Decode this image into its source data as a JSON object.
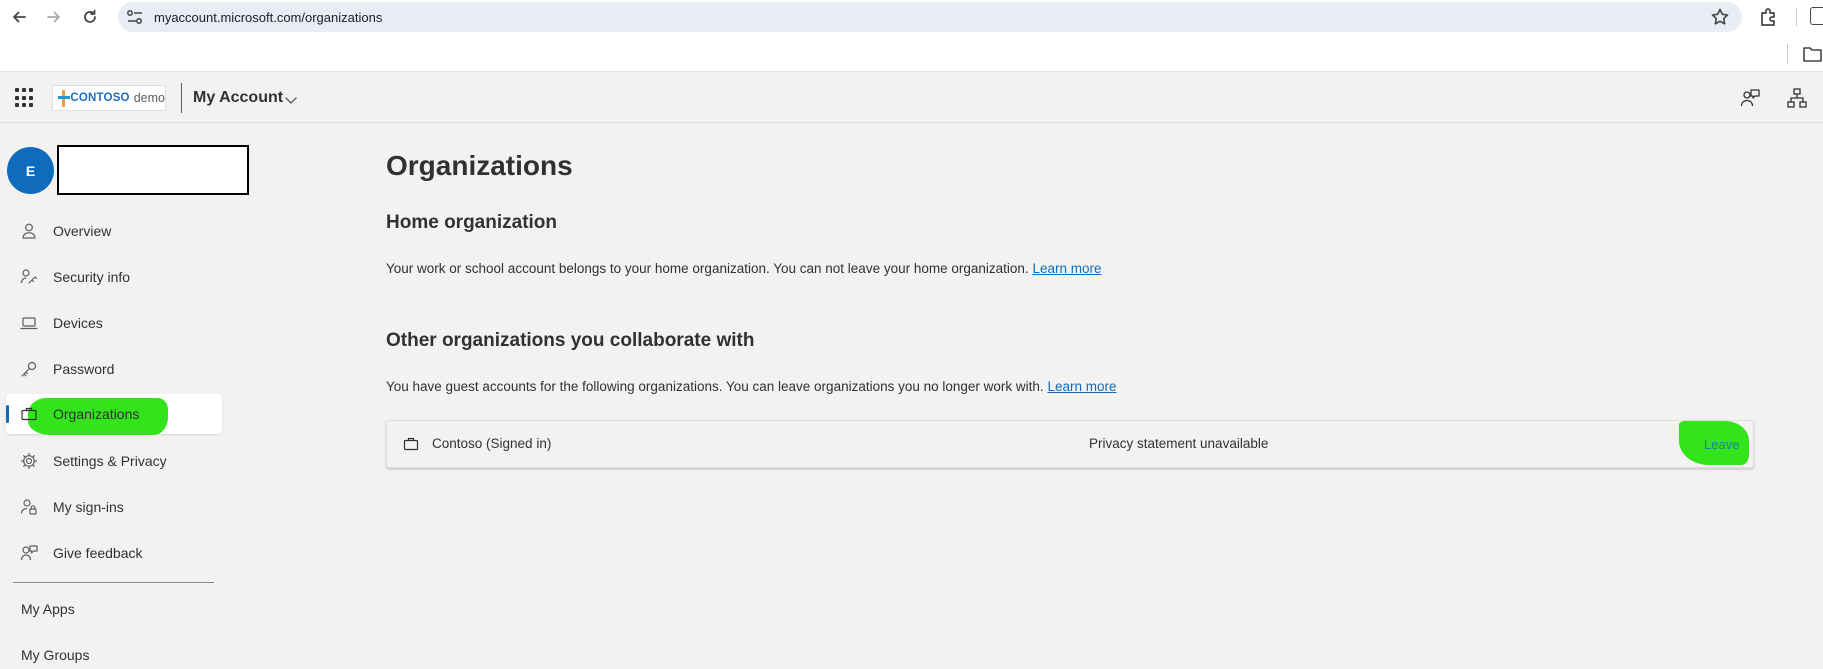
{
  "browser": {
    "url": "myaccount.microsoft.com/organizations"
  },
  "header": {
    "logo_brand": "CONTOSO",
    "logo_suffix": "demo",
    "app_title": "My Account"
  },
  "user": {
    "avatar_initial": "E"
  },
  "sidebar": {
    "items": [
      {
        "label": "Overview",
        "icon": "person-icon"
      },
      {
        "label": "Security info",
        "icon": "key-person-icon"
      },
      {
        "label": "Devices",
        "icon": "laptop-icon"
      },
      {
        "label": "Password",
        "icon": "key-icon"
      },
      {
        "label": "Organizations",
        "icon": "briefcase-icon",
        "selected": true
      },
      {
        "label": "Settings & Privacy",
        "icon": "gear-icon"
      },
      {
        "label": "My sign-ins",
        "icon": "person-lock-icon"
      },
      {
        "label": "Give feedback",
        "icon": "feedback-icon"
      }
    ],
    "bottom_links": [
      "My Apps",
      "My Groups"
    ]
  },
  "main": {
    "title": "Organizations",
    "home": {
      "heading": "Home organization",
      "text": "Your work or school account belongs to your home organization. You can not leave your home organization.",
      "link": "Learn more"
    },
    "other": {
      "heading": "Other organizations you collaborate with",
      "text": "You have guest accounts for the following organizations. You can leave organizations you no longer work with.",
      "link": "Learn more"
    },
    "organizations": [
      {
        "name": "Contoso (Signed in)",
        "privacy": "Privacy statement unavailable",
        "action": "Leave"
      }
    ]
  },
  "colors": {
    "accent": "#0f6cbd",
    "highlight": "#33e31b",
    "background": "#f3f2f1"
  }
}
